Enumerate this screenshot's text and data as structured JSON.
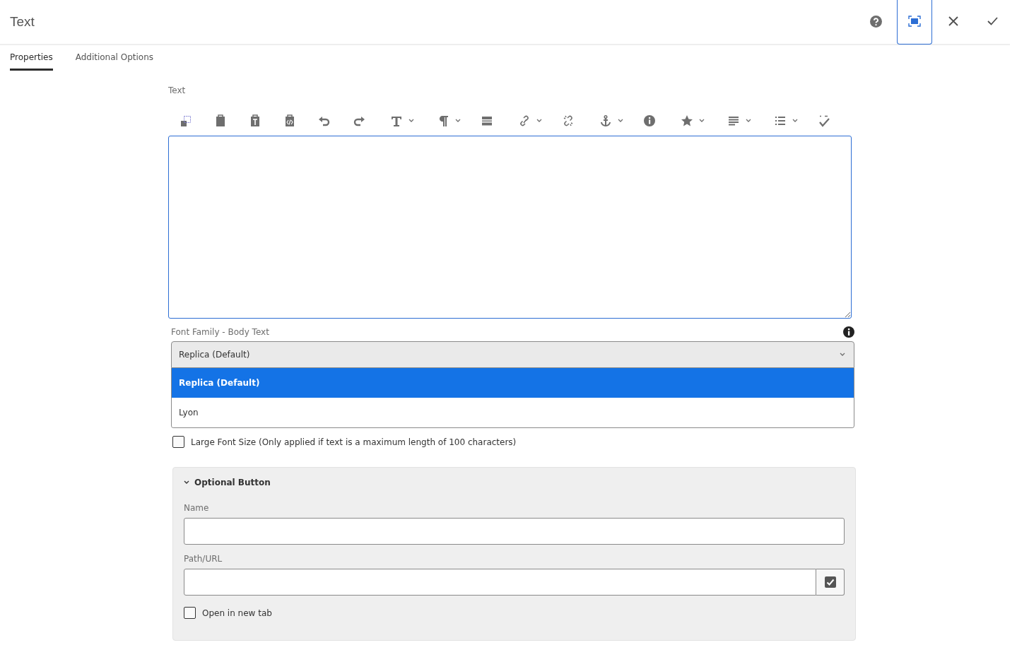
{
  "header": {
    "title": "Text",
    "actions": [
      {
        "kind": "help",
        "selected": false
      },
      {
        "kind": "fullscreen",
        "selected": true
      },
      {
        "kind": "close",
        "selected": false
      },
      {
        "kind": "done",
        "selected": false
      }
    ]
  },
  "tabs": [
    {
      "label": "Properties",
      "selected": true
    },
    {
      "label": "Additional Options",
      "selected": false
    }
  ],
  "editor": {
    "label": "Text",
    "toolbar": [
      {
        "kind": "cut",
        "menu": false
      },
      {
        "kind": "paste",
        "menu": false
      },
      {
        "kind": "paste-text",
        "menu": false
      },
      {
        "kind": "paste-code",
        "menu": false
      },
      {
        "kind": "undo",
        "menu": false
      },
      {
        "kind": "redo",
        "menu": false
      },
      {
        "kind": "format",
        "menu": true
      },
      {
        "kind": "paragraph",
        "menu": true
      },
      {
        "kind": "rule",
        "menu": false
      },
      {
        "kind": "link",
        "menu": true
      },
      {
        "kind": "unlink",
        "menu": false
      },
      {
        "kind": "anchor",
        "menu": true
      },
      {
        "kind": "info",
        "menu": false
      },
      {
        "kind": "star",
        "menu": true
      },
      {
        "kind": "align",
        "menu": true
      },
      {
        "kind": "list",
        "menu": true
      },
      {
        "kind": "spell",
        "menu": false
      }
    ]
  },
  "font_family": {
    "label": "Font Family - Body Text",
    "value": "Replica (Default)",
    "expanded": true,
    "options": [
      {
        "label": "Replica (Default)",
        "selected": true
      },
      {
        "label": "Lyon",
        "selected": false
      }
    ]
  },
  "large_font": {
    "label": "Large Font Size (Only applied if text is a maximum length of 100 characters)",
    "checked": false
  },
  "optional_button": {
    "title": "Optional Button",
    "expanded": true,
    "name_label": "Name",
    "path_label": "Path/URL",
    "open_new_tab": {
      "label": "Open in new tab",
      "checked": false
    }
  }
}
